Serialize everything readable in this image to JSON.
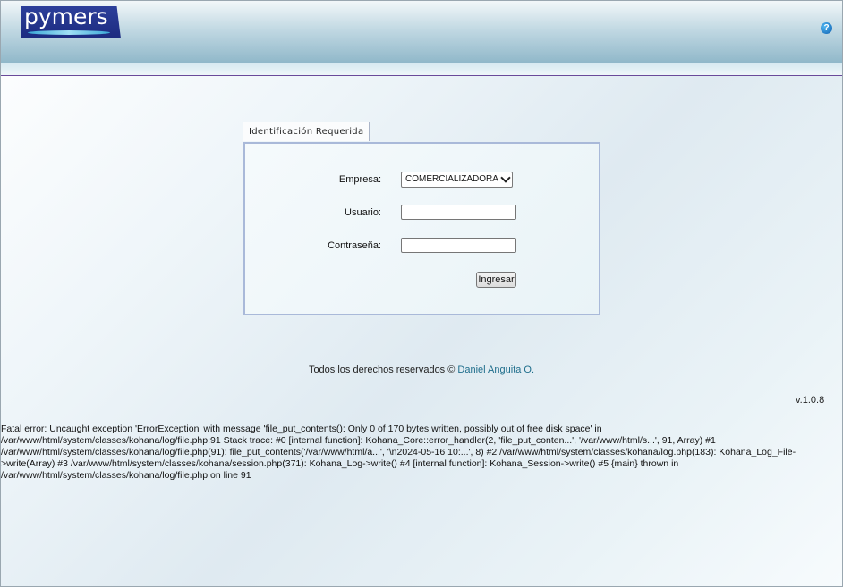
{
  "header": {
    "logo_text": "pymers",
    "help_icon": "help-icon",
    "help_glyph": "?"
  },
  "login": {
    "tab_label": "Identificación Requerida",
    "empresa_label": "Empresa:",
    "empresa_selected": "COMERCIALIZADORA",
    "usuario_label": "Usuario:",
    "usuario_value": "",
    "password_label": "Contraseña:",
    "password_value": "",
    "submit_label": "Ingresar"
  },
  "footer": {
    "rights_text": "Todos los derechos reservados ©",
    "author_link": "Daniel Anguita O.",
    "version": "v.1.0.8"
  },
  "error": {
    "lines": [
      "Fatal error: Uncaught exception 'ErrorException' with message 'file_put_contents(): Only 0 of 170 bytes written, possibly out of free disk space' in",
      "/var/www/html/system/classes/kohana/log/file.php:91 Stack trace: #0 [internal function]: Kohana_Core::error_handler(2, 'file_put_conten...', '/var/www/html/s...', 91, Array) #1",
      "/var/www/html/system/classes/kohana/log/file.php(91): file_put_contents('/var/www/html/a...', '\\n2024-05-16 10:...', 8) #2 /var/www/html/system/classes/kohana/log.php(183): Kohana_Log_File-",
      ">write(Array) #3 /var/www/html/system/classes/kohana/session.php(371): Kohana_Log->write() #4 [internal function]: Kohana_Session->write() #5 {main} thrown in",
      "/var/www/html/system/classes/kohana/log/file.php on line 91"
    ]
  },
  "colors": {
    "logo_bg": "#1c2b80",
    "link": "#1f6e8c",
    "box_border": "#a9b9d9",
    "header_rule": "#6a4a9a"
  }
}
